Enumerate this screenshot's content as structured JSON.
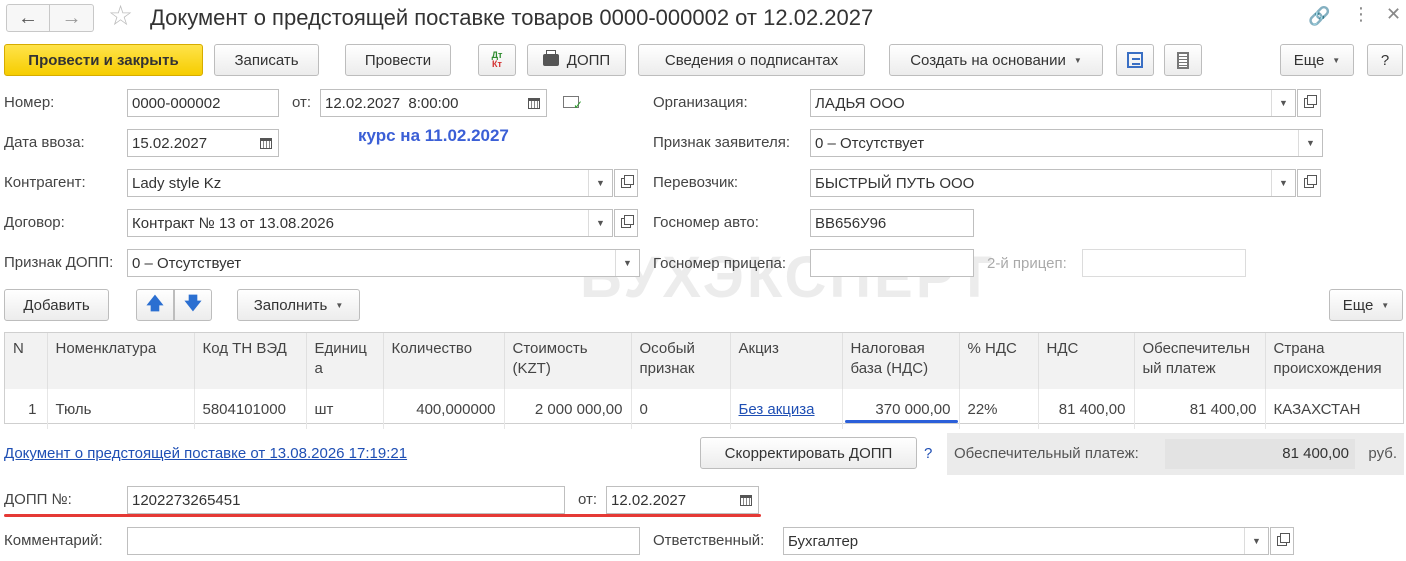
{
  "title": "Документ о предстоящей поставке товаров 0000-000002 от 12.02.2027",
  "toolbar": {
    "post_close": "Провести и закрыть",
    "save": "Записать",
    "post": "Провести",
    "dt_kt_top": "Дт",
    "dt_kt_bottom": "Кт",
    "dopp_print": "ДОПП",
    "signers": "Сведения о подписантах",
    "create_based": "Создать на основании",
    "more": "Еще",
    "help": "?"
  },
  "header": {
    "number_label": "Номер:",
    "number_value": "0000-000002",
    "from_label": "от:",
    "date_value": "12.02.2027  8:00:00",
    "import_date_label": "Дата ввоза:",
    "import_date_value": "15.02.2027",
    "rate_note": "курс на 11.02.2027",
    "counterparty_label": "Контрагент:",
    "counterparty_value": "Lady style Kz",
    "contract_label": "Договор:",
    "contract_value": "Контракт № 13 от 13.08.2026",
    "dopp_sign_label": "Признак ДОПП:",
    "dopp_sign_value": "0 – Отсутствует",
    "org_label": "Организация:",
    "org_value": "ЛАДЬЯ ООО",
    "applicant_label": "Признак заявителя:",
    "applicant_value": "0 – Отсутствует",
    "carrier_label": "Перевозчик:",
    "carrier_value": "БЫСТРЫЙ ПУТЬ ООО",
    "plate_label": "Госномер авто:",
    "plate_value": "ВВ656У96",
    "trailer_label": "Госномер прицепа:",
    "trailer_value": "",
    "trailer2_label": "2-й прицеп:",
    "trailer2_value": ""
  },
  "table_toolbar": {
    "add": "Добавить",
    "fill": "Заполнить",
    "more": "Еще"
  },
  "table": {
    "headers": [
      "N",
      "Номенклатура",
      "Код ТН ВЭД",
      "Единица",
      "Количество",
      "Стоимость (KZT)",
      "Особый признак",
      "Акциз",
      "Налоговая база (НДС)",
      "% НДС",
      "НДС",
      "Обеспечительный платеж",
      "Страна происхождения"
    ],
    "rows": [
      [
        "1",
        "Тюль",
        "5804101000",
        "шт",
        "400,000000",
        "2 000 000,00",
        "0",
        "Без акциза",
        "370 000,00",
        "22%",
        "81 400,00",
        "81 400,00",
        "КАЗАХСТАН"
      ]
    ]
  },
  "footer": {
    "doc_link": "Документ о предстоящей поставке от 13.08.2026 17:19:21",
    "correct_button": "Скорректировать ДОПП",
    "help": "?",
    "security_label": "Обеспечительный платеж:",
    "security_value": "81 400,00",
    "currency": "руб.",
    "dopp_no_label": "ДОПП №:",
    "dopp_no_value": "1202273265451",
    "dopp_from_label": "от:",
    "dopp_date_value": "12.02.2027",
    "comment_label": "Комментарий:",
    "comment_value": "",
    "responsible_label": "Ответственный:",
    "responsible_value": "Бухгалтер"
  },
  "watermark": "БУХЭКСПЕРТ",
  "colors": {
    "primary_button": "#f6cd00",
    "rate_note": "#3b5fd6",
    "link": "#1f4fb4",
    "underline_red": "#e53935",
    "underline_blue": "#2b5fd9"
  }
}
